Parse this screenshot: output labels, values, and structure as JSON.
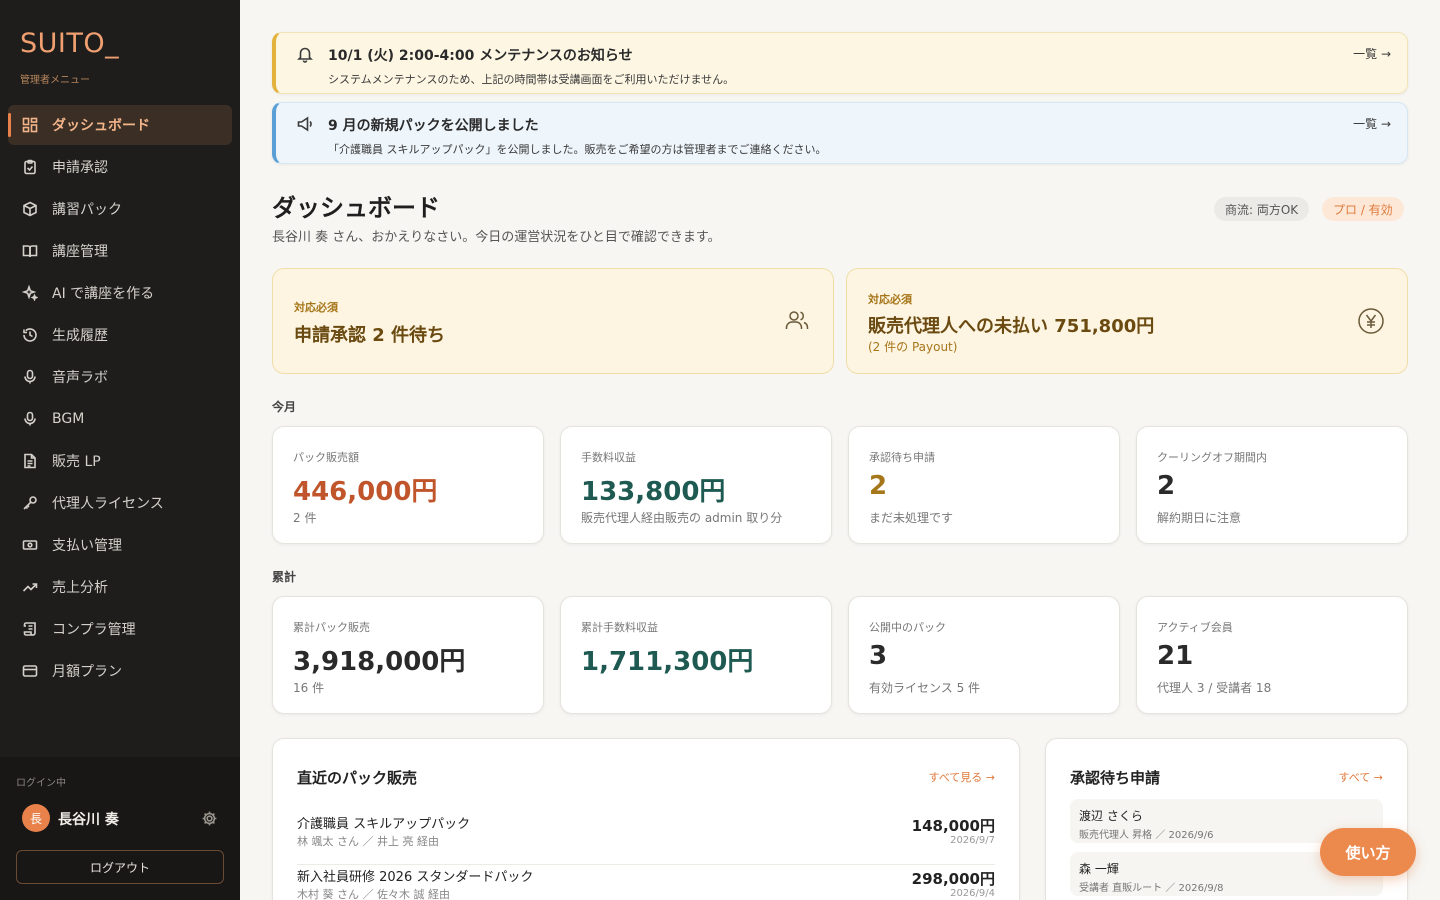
{
  "brand": {
    "name": "SUITO_",
    "subtitle": "管理者メニュー"
  },
  "sidebar": {
    "items": [
      {
        "label": "ダッシュボード",
        "icon": "dashboard-icon",
        "active": true
      },
      {
        "label": "申請承認",
        "icon": "clipboard-check-icon"
      },
      {
        "label": "講習パック",
        "icon": "package-icon"
      },
      {
        "label": "講座管理",
        "icon": "book-icon"
      },
      {
        "label": "AI で講座を作る",
        "icon": "sparkles-icon"
      },
      {
        "label": "生成履歴",
        "icon": "history-icon"
      },
      {
        "label": "音声ラボ",
        "icon": "microphone-icon"
      },
      {
        "label": "BGM",
        "icon": "microphone-icon"
      },
      {
        "label": "販売 LP",
        "icon": "file-text-icon"
      },
      {
        "label": "代理人ライセンス",
        "icon": "key-icon"
      },
      {
        "label": "支払い管理",
        "icon": "banknote-icon"
      },
      {
        "label": "売上分析",
        "icon": "trending-up-icon"
      },
      {
        "label": "コンプラ管理",
        "icon": "scroll-icon"
      },
      {
        "label": "月額プラン",
        "icon": "credit-card-icon"
      }
    ],
    "login_label": "ログイン中",
    "user_initial": "長",
    "user_name": "長谷川 奏",
    "logout_label": "ログアウト"
  },
  "notices": [
    {
      "title": "10/1 (火) 2:00-4:00 メンテナンスのお知らせ",
      "body": "システムメンテナンスのため、上記の時間帯は受講画面をご利用いただけません。",
      "link": "一覧 →",
      "icon": "bell-icon"
    },
    {
      "title": "9 月の新規パックを公開しました",
      "body": "「介護職員 スキルアップパック」を公開しました。販売をご希望の方は管理者までご連絡ください。",
      "link": "一覧 →",
      "icon": "megaphone-icon"
    }
  ],
  "header": {
    "title": "ダッシュボード",
    "subtitle": "長谷川 奏 さん、おかえりなさい。今日の運営状況をひと目で確認できます。",
    "tag_flow": "商流: 両方OK",
    "tag_plan": "プロ / 有効"
  },
  "alerts": [
    {
      "label": "対応必須",
      "title": "申請承認 2 件待ち",
      "sub": "",
      "icon": "users-icon"
    },
    {
      "label": "対応必須",
      "title": "販売代理人への未払い 751,800円",
      "sub": "(2 件の Payout)",
      "icon": "yen-icon"
    }
  ],
  "month": {
    "label": "今月",
    "stats": [
      {
        "label": "パック販売額",
        "value": "446,000円",
        "sub": "2 件",
        "color": "#c0542a"
      },
      {
        "label": "手数料収益",
        "value": "133,800円",
        "sub": "販売代理人経由販売の admin 取り分",
        "color": "#1f5a52"
      },
      {
        "label": "承認待ち申請",
        "value": "2",
        "sub": "まだ未処理です",
        "color": "#a6761a"
      },
      {
        "label": "クーリングオフ期間内",
        "value": "2",
        "sub": "解約期日に注意",
        "color": "#2a2a2a"
      }
    ]
  },
  "total": {
    "label": "累計",
    "stats": [
      {
        "label": "累計パック販売",
        "value": "3,918,000円",
        "sub": "16 件",
        "color": "#2a2a2a"
      },
      {
        "label": "累計手数料収益",
        "value": "1,711,300円",
        "sub": "",
        "color": "#1f5a52"
      },
      {
        "label": "公開中のパック",
        "value": "3",
        "sub": "有効ライセンス 5 件",
        "color": "#2a2a2a"
      },
      {
        "label": "アクティブ会員",
        "value": "21",
        "sub": "代理人 3 / 受講者 18",
        "color": "#2a2a2a"
      }
    ]
  },
  "recent_sales": {
    "title": "直近のパック販売",
    "link": "すべて見る →",
    "rows": [
      {
        "name": "介護職員 スキルアップパック",
        "by": "林 颯太 さん ／ 井上 亮 経由",
        "amount": "148,000円",
        "date": "2026/9/7"
      },
      {
        "name": "新入社員研修 2026 スタンダードパック",
        "by": "木村 葵 さん ／ 佐々木 誠 経由",
        "amount": "298,000円",
        "date": "2026/9/4"
      }
    ]
  },
  "pending": {
    "title": "承認待ち申請",
    "link": "すべて →",
    "rows": [
      {
        "name": "渡辺 さくら",
        "meta": "販売代理人 昇格 ／ 2026/9/6"
      },
      {
        "name": "森 一輝",
        "meta": "受講者 直販ルート ／ 2026/9/8"
      }
    ]
  },
  "help_button": "使い方"
}
